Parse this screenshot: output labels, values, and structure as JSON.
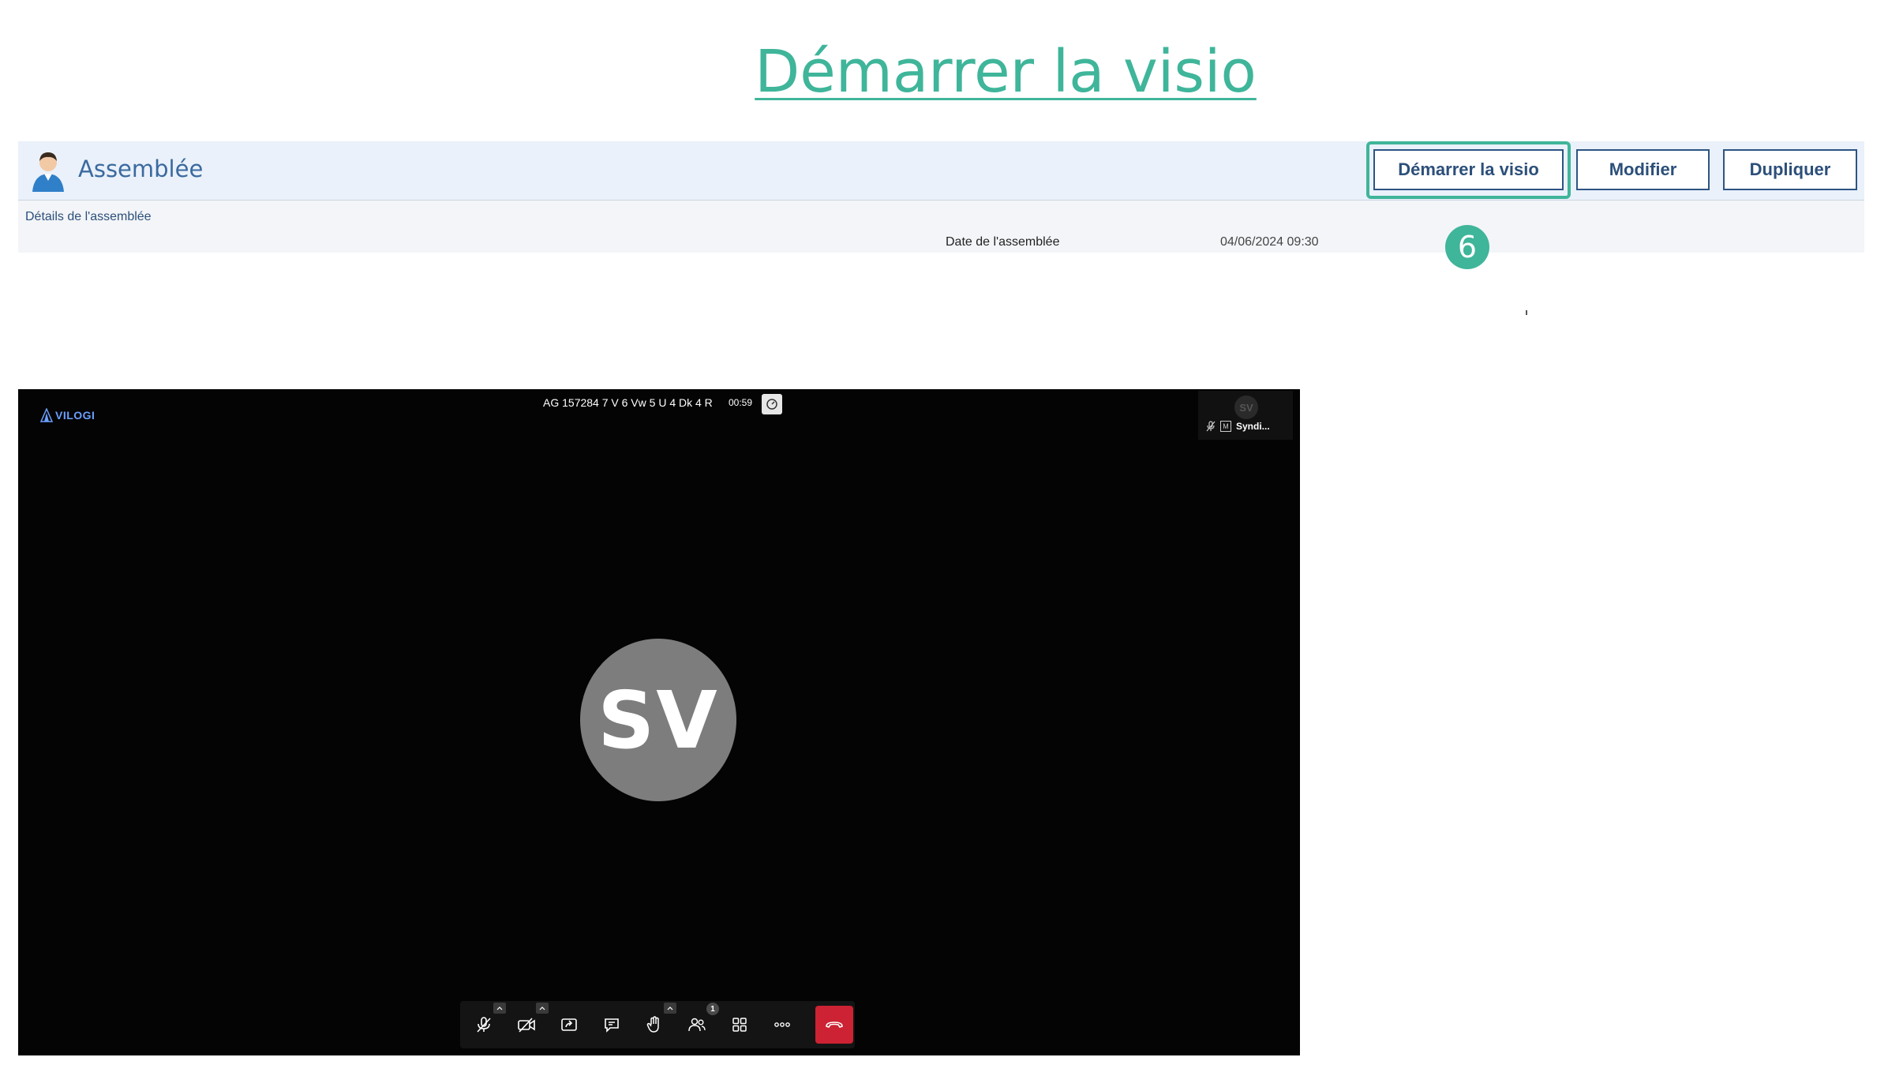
{
  "slide": {
    "title": "Démarrer la visio",
    "step_number": "6"
  },
  "panel": {
    "title": "Assemblée",
    "buttons": {
      "start": "Démarrer la visio",
      "modify": "Modifier",
      "duplicate": "Dupliquer"
    },
    "section_label": "Détails de l'assemblée",
    "date_label": "Date de l'assemblée",
    "date_value": "04/06/2024 09:30"
  },
  "video": {
    "logo_text": "VILOGI",
    "meeting_name": "AG 157284 7 V 6 Vw 5 U 4 Dk 4 R",
    "timer": "00:59",
    "thumbnail": {
      "initials": "SV",
      "moderator_badge": "M",
      "name": "Syndi..."
    },
    "avatar_initials": "SV",
    "participants_count": "1",
    "toolbar_icons": [
      "microphone-muted-icon",
      "camera-off-icon",
      "screen-share-icon",
      "chat-icon",
      "raise-hand-icon",
      "participants-icon",
      "tile-view-icon",
      "more-options-icon",
      "hangup-icon"
    ]
  },
  "colors": {
    "accent_green": "#3fb59a",
    "panel_blue": "#2c5583",
    "hangup_red": "#cc2233"
  }
}
